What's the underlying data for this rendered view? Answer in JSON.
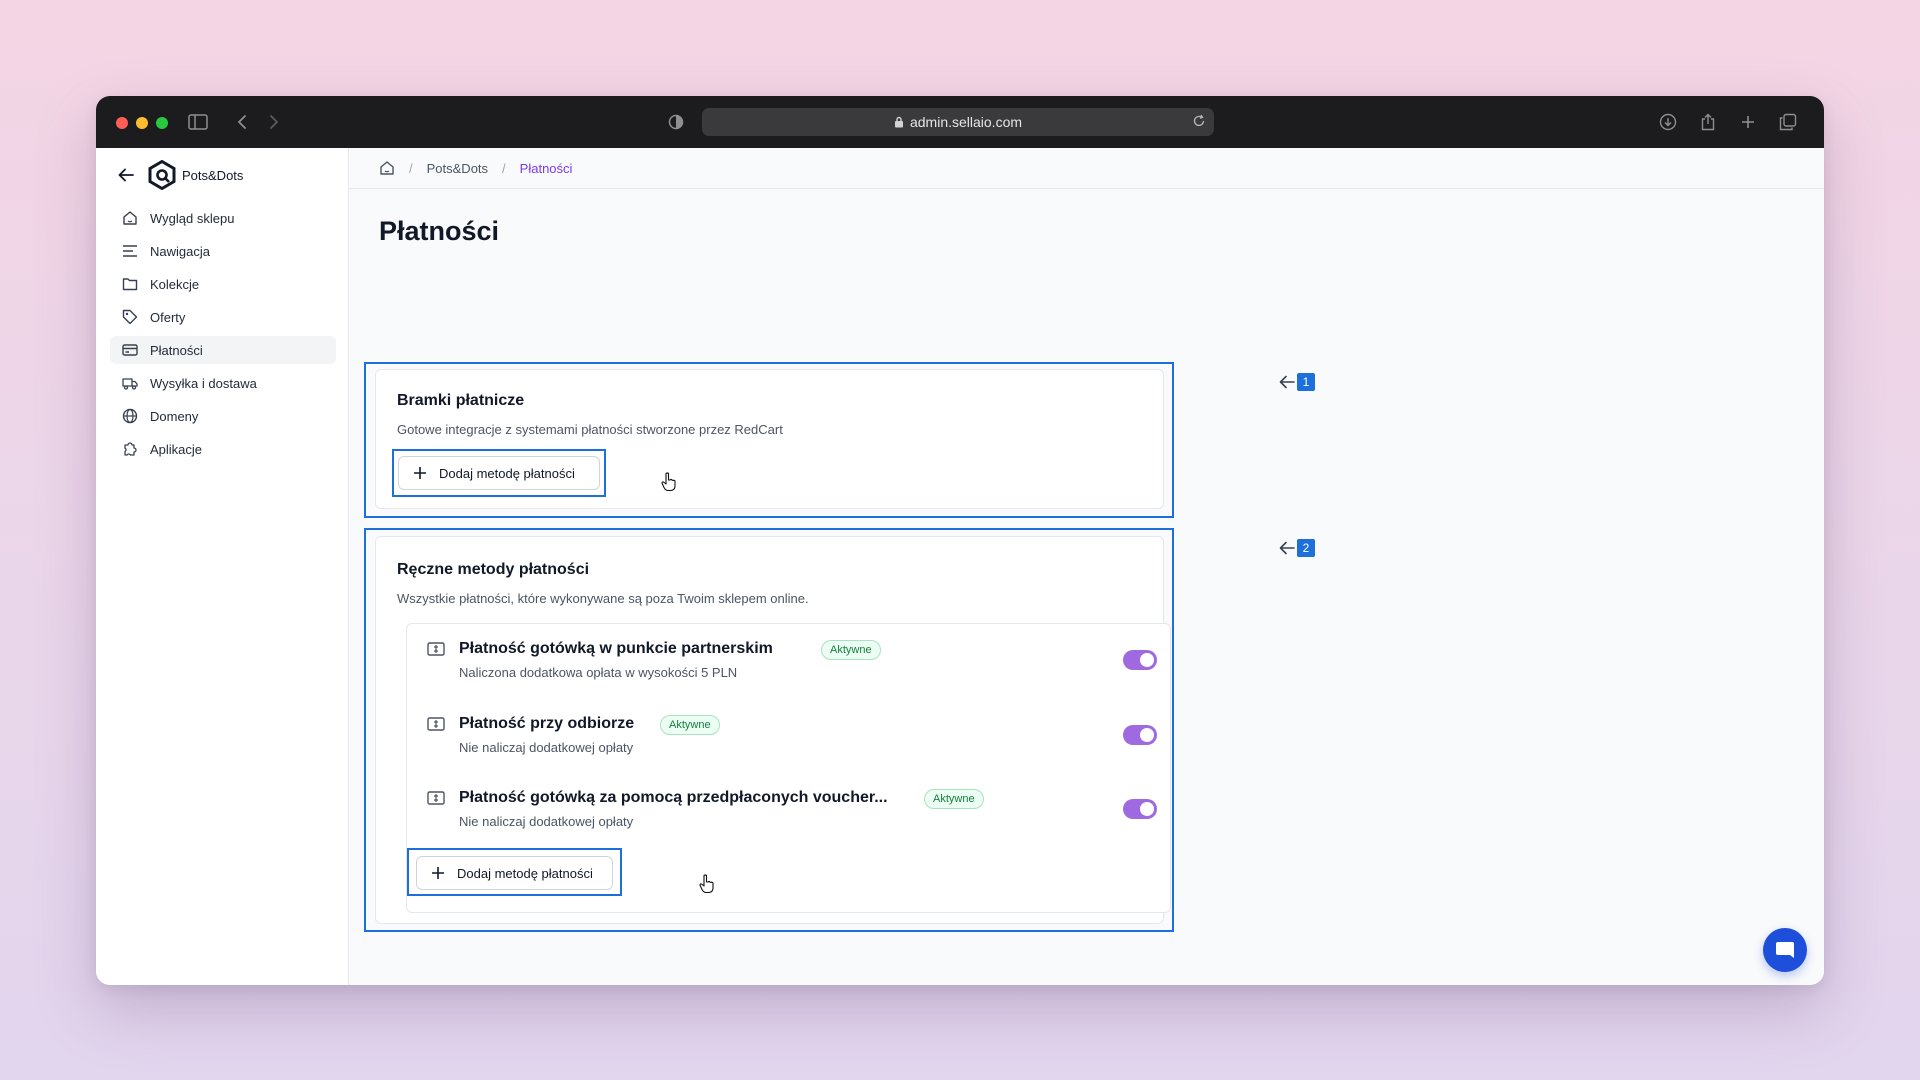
{
  "browser": {
    "url": "admin.sellaio.com"
  },
  "sidebar": {
    "store_name": "Pots&Dots",
    "items": [
      {
        "label": "Wygląd sklepu",
        "icon": "home-icon"
      },
      {
        "label": "Nawigacja",
        "icon": "menu-lines-icon"
      },
      {
        "label": "Kolekcje",
        "icon": "folder-icon"
      },
      {
        "label": "Oferty",
        "icon": "tag-icon"
      },
      {
        "label": "Płatności",
        "icon": "credit-card-icon",
        "active": true
      },
      {
        "label": "Wysyłka i dostawa",
        "icon": "truck-icon"
      },
      {
        "label": "Domeny",
        "icon": "globe-icon"
      },
      {
        "label": "Aplikacje",
        "icon": "puzzle-icon"
      }
    ]
  },
  "breadcrumb": {
    "store": "Pots&Dots",
    "current": "Płatności"
  },
  "page": {
    "title": "Płatności"
  },
  "gateways": {
    "title": "Bramki płatnicze",
    "subtitle": "Gotowe integracje z systemami płatności stworzone przez RedCart",
    "button_label": "Dodaj metodę płatności",
    "callout_number": "1"
  },
  "manual": {
    "title": "Ręczne metody płatności",
    "subtitle": "Wszystkie płatności, które wykonywane są poza Twoim sklepem online.",
    "button_label": "Dodaj metodę płatności",
    "callout_number": "2",
    "methods": [
      {
        "name": "Płatność gotówką w punkcie partnerskim",
        "badge": "Aktywne",
        "description": "Naliczona dodatkowa opłata w wysokości 5 PLN",
        "enabled": true
      },
      {
        "name": "Płatność przy odbiorze",
        "badge": "Aktywne",
        "description": "Nie naliczaj dodatkowej opłaty",
        "enabled": true
      },
      {
        "name": "Płatność gotówką za pomocą przedpłaconych voucher...",
        "badge": "Aktywne",
        "description": "Nie naliczaj dodatkowej opłaty",
        "enabled": true
      }
    ]
  },
  "colors": {
    "accent": "#7c3aed",
    "toggle_on": "#9f6ae0",
    "highlight": "#1d6fdc",
    "badge_text": "#15803d"
  }
}
